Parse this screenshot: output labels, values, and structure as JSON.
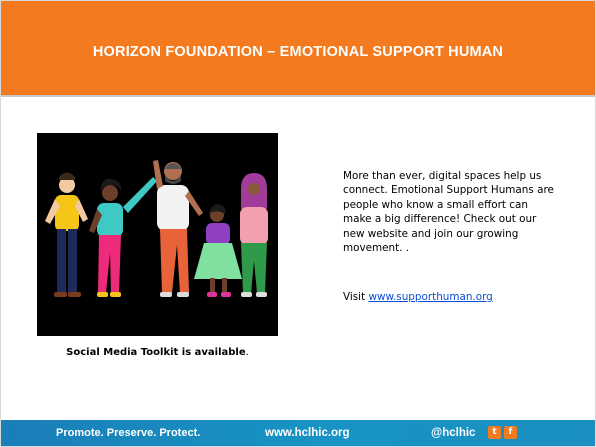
{
  "slide": {
    "title": "HORIZON FOUNDATION – EMOTIONAL SUPPORT HUMAN",
    "body": "More than ever, digital spaces help us connect. Emotional Support Humans are people who know a small effort can make a big difference! Check out our new website and join our growing movement. .",
    "visit_prefix": "Visit ",
    "visit_link": "www.supporthuman.org",
    "caption_bold": "Social Media Toolkit is available",
    "caption_tail": "."
  },
  "footer": {
    "tagline": "Promote. Preserve. Protect.",
    "url": "www.hclhic.org",
    "handle": "@hclhic",
    "twitter_glyph": "t",
    "facebook_glyph": "f"
  },
  "colors": {
    "title_bar": "#f47a20",
    "footer": "#1a8fc0",
    "link": "#0b4fd6",
    "image_bg": "#000000"
  }
}
